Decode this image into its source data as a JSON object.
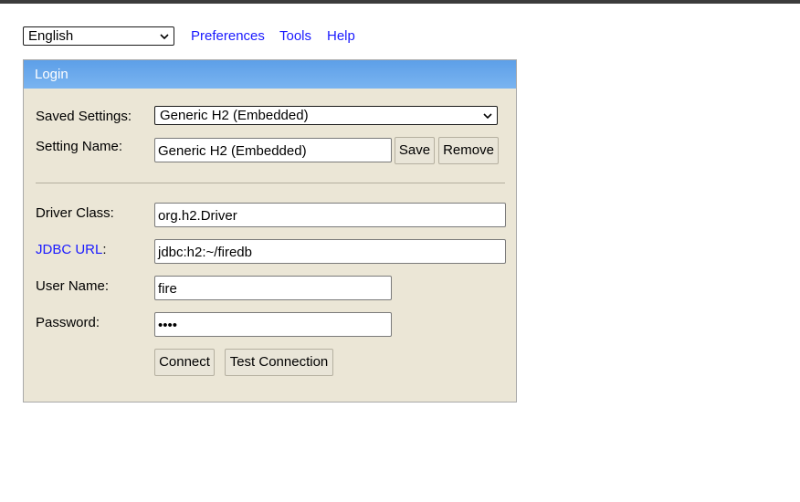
{
  "header": {
    "language": "English",
    "links": [
      "Preferences",
      "Tools",
      "Help"
    ]
  },
  "login": {
    "title": "Login",
    "saved_settings_label": "Saved Settings:",
    "saved_settings_value": "Generic H2 (Embedded)",
    "setting_name_label": "Setting Name:",
    "setting_name_value": "Generic H2 (Embedded)",
    "save_label": "Save",
    "remove_label": "Remove",
    "driver_class_label": "Driver Class:",
    "driver_class_value": "org.h2.Driver",
    "jdbc_url_link": "JDBC URL",
    "jdbc_url_colon": ":",
    "jdbc_url_value": "jdbc:h2:~/firedb",
    "user_name_label": "User Name:",
    "user_name_value": "fire",
    "password_label": "Password:",
    "password_value": "••••",
    "connect_label": "Connect",
    "test_connection_label": "Test Connection"
  },
  "colors": {
    "link": "#1a1aff",
    "panel_bg": "#ebe6d6",
    "header_gradient_top": "#5d9fe8",
    "header_gradient_bottom": "#7ab4f0"
  },
  "icons": {
    "dropdown": "chevron-down-icon"
  }
}
